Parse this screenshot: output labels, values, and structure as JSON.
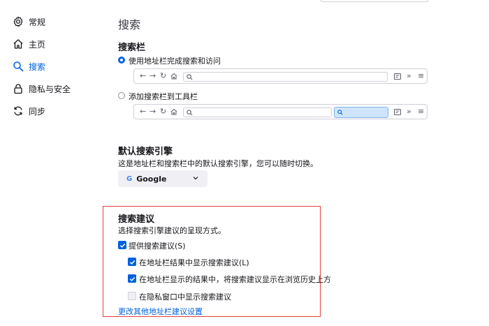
{
  "sidebar": {
    "items": [
      {
        "label": "常规",
        "icon": "gear-icon"
      },
      {
        "label": "主页",
        "icon": "home-icon"
      },
      {
        "label": "搜索",
        "icon": "search-icon",
        "active": true
      },
      {
        "label": "隐私与安全",
        "icon": "lock-icon"
      },
      {
        "label": "同步",
        "icon": "sync-icon"
      }
    ]
  },
  "main": {
    "title": "搜索",
    "searchbar": {
      "heading": "搜索栏",
      "options": [
        {
          "label": "使用地址栏完成搜索和访问",
          "selected": true
        },
        {
          "label": "添加搜索栏到工具栏",
          "selected": false
        }
      ],
      "preview_glyphs": {
        "back": "←",
        "forward": "→",
        "reload": "↻",
        "overflow": "»",
        "menu": "≡"
      }
    },
    "default_engine": {
      "heading": "默认搜索引擎",
      "description": "这是地址栏和搜索栏中的默认搜索引擎，您可以随时切换。",
      "selected": "Google",
      "logo_letter": "G"
    },
    "suggestions": {
      "heading": "搜索建议",
      "description": "选择搜索引擎建议的呈现方式。",
      "checkboxes": [
        {
          "label": "提供搜索建议(S)",
          "checked": true
        },
        {
          "label": "在地址栏结果中显示搜索建议(L)",
          "checked": true
        },
        {
          "label": "在地址栏显示的结果中，将搜索建议显示在浏览历史上方",
          "checked": true
        },
        {
          "label": "在隐私窗口中显示搜索建议",
          "checked": false,
          "disabled": true
        }
      ],
      "link": "更改其他地址栏建议设置"
    }
  },
  "colors": {
    "accent": "#0061e0",
    "highlight": "#e04040"
  }
}
